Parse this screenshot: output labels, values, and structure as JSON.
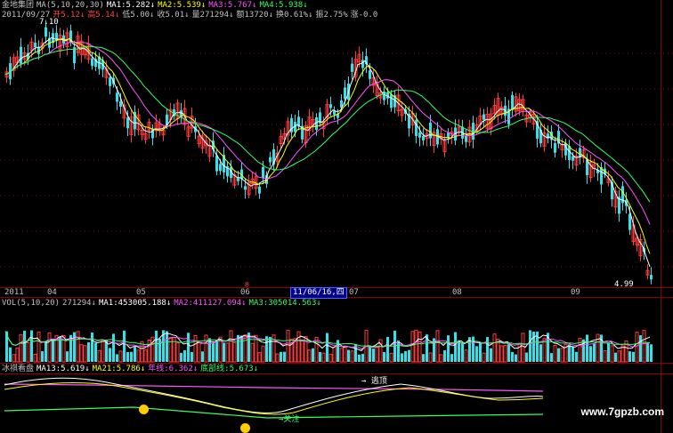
{
  "colors": {
    "up": "#ff3b3b",
    "down": "#37e0e8",
    "ma1": "#ffffff",
    "ma2": "#ffff00",
    "ma3": "#ff55ff",
    "ma4": "#33ff66",
    "grid": "#8b0000",
    "accent": "#ffff00"
  },
  "price_panel": {
    "header1": [
      {
        "text": "金地集团",
        "color": "#c0c0c0"
      },
      {
        "text": "MA(5,10,20,30)",
        "color": "#c0c0c0"
      },
      {
        "text": "MA1:5.282",
        "color": "#ffffff",
        "arrow": "↓"
      },
      {
        "text": "MA2:5.539",
        "color": "#ffff00",
        "arrow": "↓"
      },
      {
        "text": "MA3:5.767",
        "color": "#ff55ff",
        "arrow": "↓"
      },
      {
        "text": "MA4:5.938",
        "color": "#33ff66",
        "arrow": "↓"
      }
    ],
    "header2": [
      {
        "text": "2011/09/27",
        "color": "#c0c0c0"
      },
      {
        "text": "开5.12",
        "color": "#ff4444",
        "arrow": "↓"
      },
      {
        "text": "高5.14",
        "color": "#ff4444",
        "arrow": "↓"
      },
      {
        "text": "低5.00",
        "color": "#c0c0c0",
        "arrow": "↓"
      },
      {
        "text": "收5.01",
        "color": "#c0c0c0",
        "arrow": "↓"
      },
      {
        "text": "量271294",
        "color": "#c0c0c0",
        "arrow": "↓"
      },
      {
        "text": "额13720",
        "color": "#c0c0c0",
        "arrow": "↓"
      },
      {
        "text": "换0.61%",
        "color": "#c0c0c0",
        "arrow": "↓"
      },
      {
        "text": "振2.75%",
        "color": "#c0c0c0",
        "arrow": ""
      },
      {
        "text": "涨-0.0",
        "color": "#c0c0c0",
        "arrow": ""
      }
    ],
    "high_label": "7.10",
    "low_label": "4.99",
    "marker": "※"
  },
  "timeline": {
    "labels": [
      "2011",
      "04",
      "05",
      "06",
      "07",
      "08",
      "09"
    ],
    "current_date": "11/06/16,四"
  },
  "volume_panel": {
    "header": [
      {
        "text": "VOL(5,10,20)",
        "color": "#c0c0c0"
      },
      {
        "text": "271294",
        "color": "#c0c0c0",
        "arrow": "↓"
      },
      {
        "text": "MA1:453005.188",
        "color": "#ffffff",
        "arrow": "↓"
      },
      {
        "text": "MA2:411127.094",
        "color": "#ff55ff",
        "arrow": "↓"
      },
      {
        "text": "MA3:305014.563",
        "color": "#33ff66",
        "arrow": "↓"
      }
    ]
  },
  "indicator_panel": {
    "header": [
      {
        "text": "冰祺看盘",
        "color": "#c0c0c0"
      },
      {
        "text": "MA13:5.619",
        "color": "#ffffff",
        "arrow": "↓"
      },
      {
        "text": "MA21:5.786",
        "color": "#ffff00",
        "arrow": "↓"
      },
      {
        "text": "年线:6.362",
        "color": "#ff55ff",
        "arrow": "↓"
      },
      {
        "text": "底部线:5.673",
        "color": "#33ff66",
        "arrow": "↓"
      }
    ],
    "label_top": "→ 逃顶",
    "label_bottom": "→关注"
  },
  "watermark": "www.7gpzb.com"
}
